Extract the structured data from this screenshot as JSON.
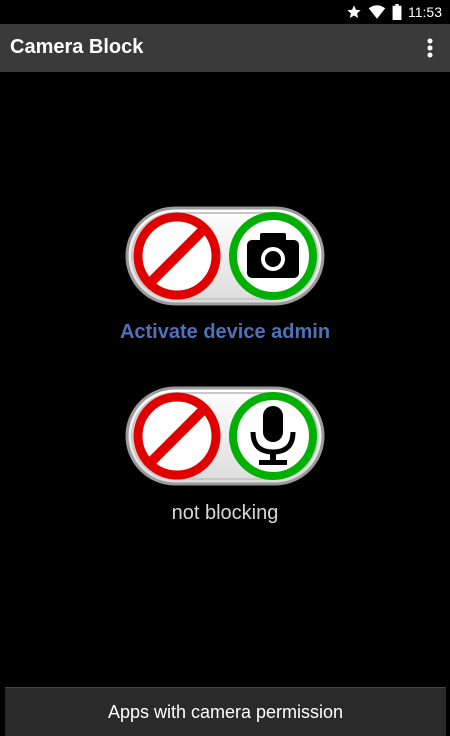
{
  "status_bar": {
    "time": "11:53",
    "icons": [
      "star-icon",
      "wifi-icon",
      "battery-icon"
    ]
  },
  "app_bar": {
    "title": "Camera Block",
    "overflow_icon": "more-vertical-icon"
  },
  "camera_toggle": {
    "left_icon": "prohibited-icon",
    "right_icon": "camera-icon",
    "left_ring_color": "#e00000",
    "right_ring_color": "#00b000"
  },
  "activate_link": "Activate device admin",
  "mic_toggle": {
    "left_icon": "prohibited-icon",
    "right_icon": "microphone-icon",
    "left_ring_color": "#e00000",
    "right_ring_color": "#00b000"
  },
  "mic_status": "not blocking",
  "bottom_button": "Apps with camera permission",
  "colors": {
    "background": "#000000",
    "app_bar": "#3a3a3a",
    "link": "#4f71b8"
  }
}
